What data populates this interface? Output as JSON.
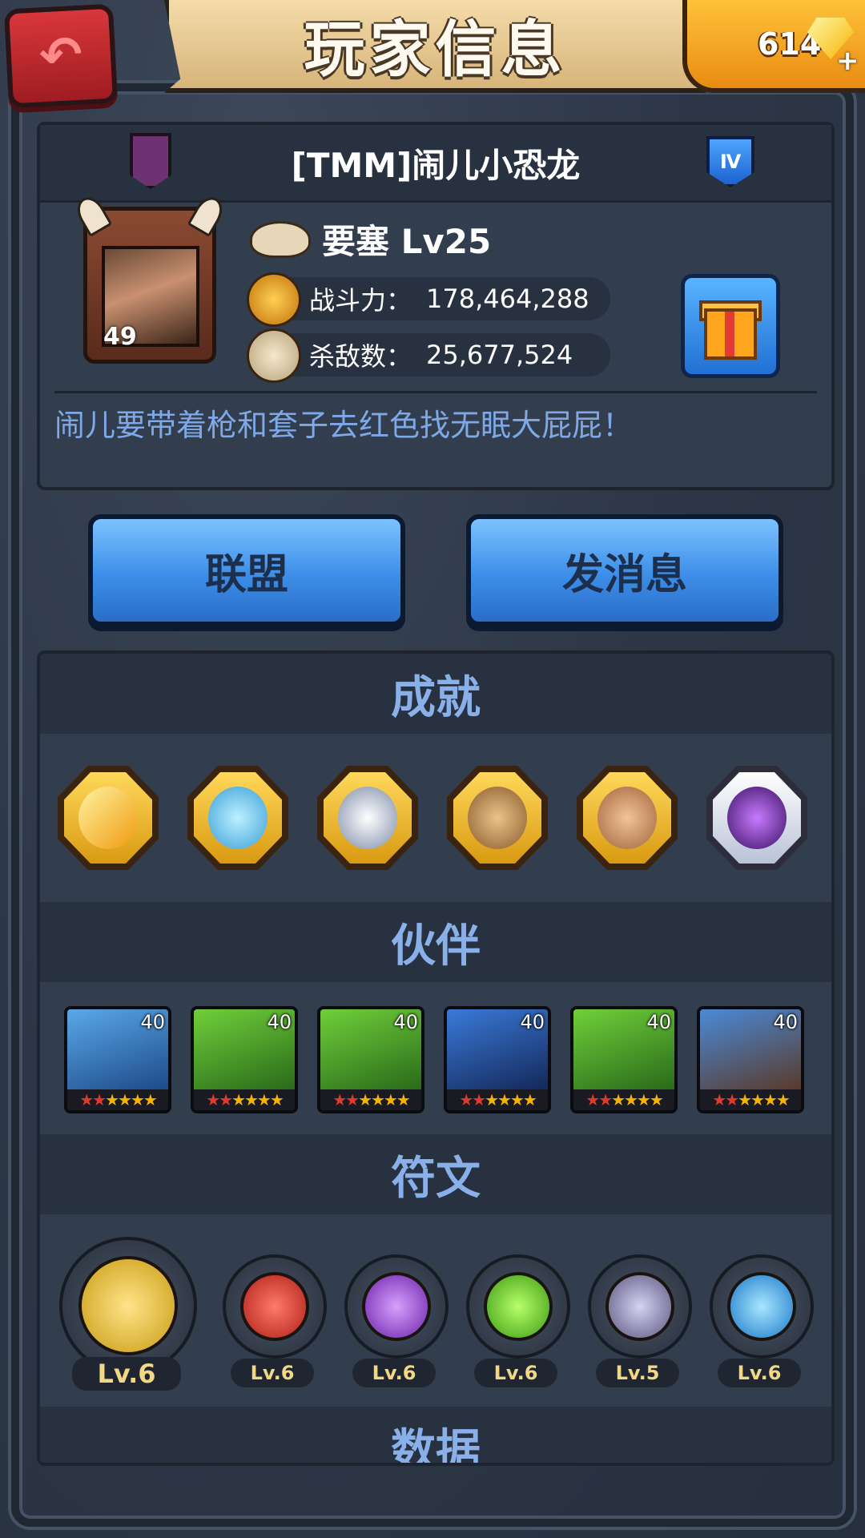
{
  "header": {
    "title": "玩家信息",
    "gems": "614"
  },
  "profile": {
    "name": "[TMM]闹儿小恐龙",
    "rank_badge": "Ⅳ",
    "avatar_level": "49",
    "fortress": "要塞 Lv25",
    "power_label": "战斗力：",
    "power_value": "178,464,288",
    "kills_label": "杀敌数：",
    "kills_value": "25,677,524",
    "motto": "闹儿要带着枪和套子去红色找无眠大屁屁！"
  },
  "buttons": {
    "alliance": "联盟",
    "message": "发消息"
  },
  "sections": {
    "achievements": "成就",
    "partners": "伙伴",
    "runes": "符文",
    "data": "数据"
  },
  "partners": [
    {
      "level": "40",
      "stars_red": 2,
      "stars_total": 6
    },
    {
      "level": "40",
      "stars_red": 2,
      "stars_total": 6
    },
    {
      "level": "40",
      "stars_red": 2,
      "stars_total": 6
    },
    {
      "level": "40",
      "stars_red": 2,
      "stars_total": 6
    },
    {
      "level": "40",
      "stars_red": 2,
      "stars_total": 6
    },
    {
      "level": "40",
      "stars_red": 2,
      "stars_total": 6
    }
  ],
  "runes": [
    {
      "level": "Lv.6",
      "color": "#f2c02c"
    },
    {
      "level": "Lv.6",
      "color": "#e0332a"
    },
    {
      "level": "Lv.6",
      "color": "#9a48d8"
    },
    {
      "level": "Lv.6",
      "color": "#6ccf2a"
    },
    {
      "level": "Lv.5",
      "color": "#8a86a8"
    },
    {
      "level": "Lv.6",
      "color": "#3aa8f0"
    }
  ],
  "colors": {
    "accent_blue": "#8ab0ea",
    "motto": "#7ea9e6",
    "gold": "#f2d784"
  }
}
